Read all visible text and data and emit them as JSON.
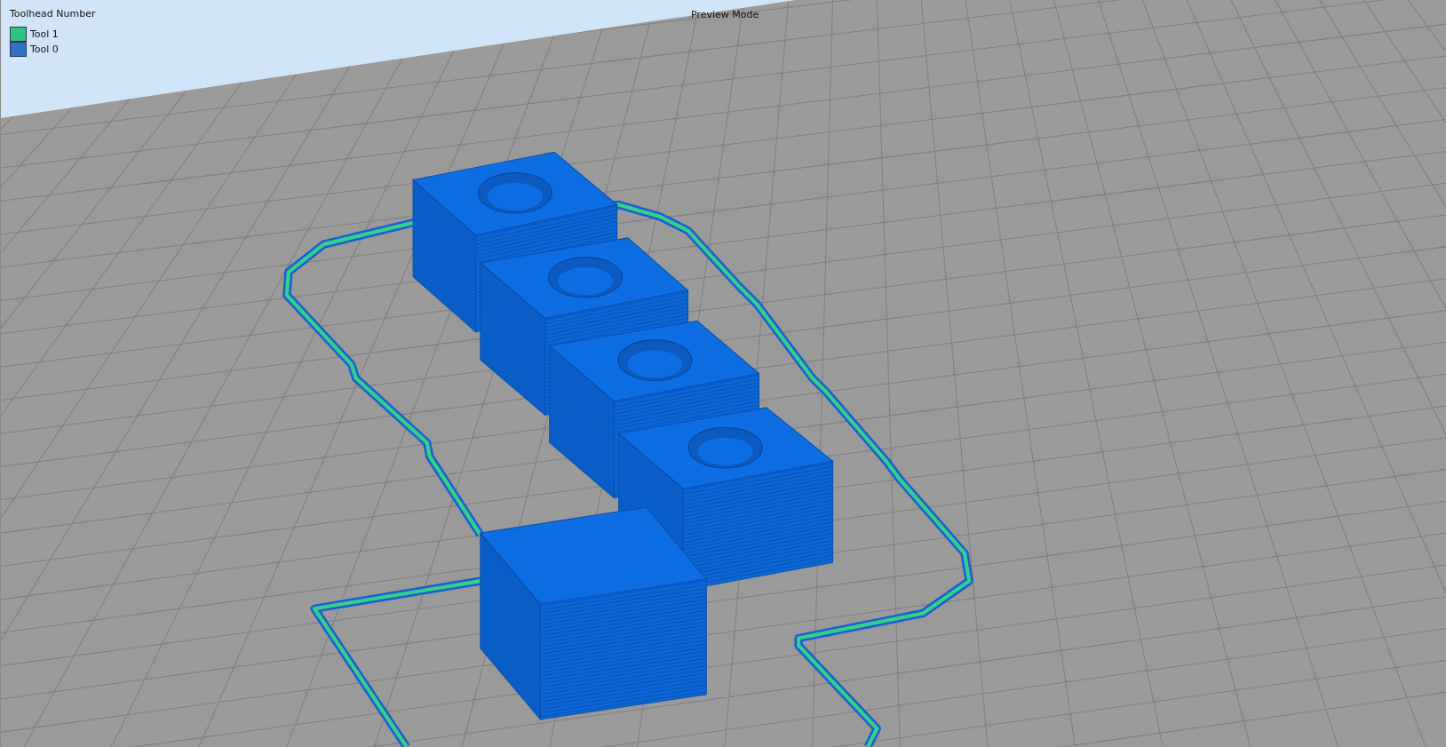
{
  "legend": {
    "title": "Toolhead Number",
    "items": [
      {
        "label": "Tool 1",
        "color": "#2fc383"
      },
      {
        "label": "Tool 0",
        "color": "#2e73c6"
      }
    ]
  },
  "mode_label": "Preview Mode"
}
